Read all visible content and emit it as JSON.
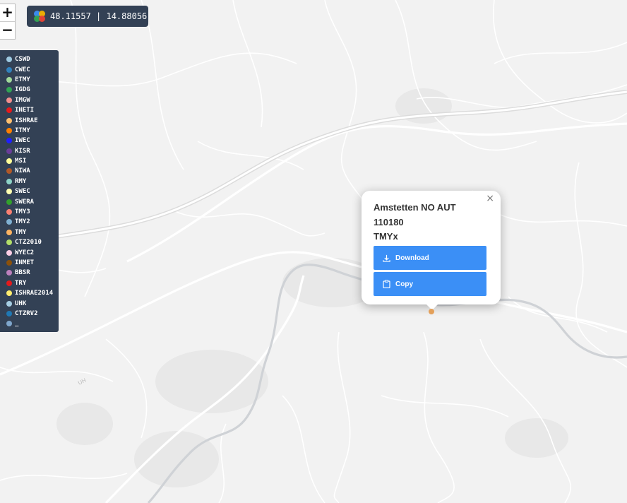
{
  "coords": {
    "text": "48.11557 | 14.88056"
  },
  "zoom": {
    "in_label": "+",
    "out_label": "−"
  },
  "legend": {
    "items": [
      {
        "label": "CSWD",
        "color": "#9ecae1"
      },
      {
        "label": "CWEC",
        "color": "#3182bd"
      },
      {
        "label": "ETMY",
        "color": "#a1d99b"
      },
      {
        "label": "IGDG",
        "color": "#31a354"
      },
      {
        "label": "IMGW",
        "color": "#f28e8e"
      },
      {
        "label": "INETI",
        "color": "#e31a1c"
      },
      {
        "label": "ISHRAE",
        "color": "#fdbf6f"
      },
      {
        "label": "ITMY",
        "color": "#ff7f00"
      },
      {
        "label": "IWEC",
        "color": "#1f1fff"
      },
      {
        "label": "KISR",
        "color": "#6a3d9a"
      },
      {
        "label": "MSI",
        "color": "#ffff99"
      },
      {
        "label": "NIWA",
        "color": "#b15928"
      },
      {
        "label": "RMY",
        "color": "#8dd3c7"
      },
      {
        "label": "SWEC",
        "color": "#ffffb3"
      },
      {
        "label": "SWERA",
        "color": "#33a02c"
      },
      {
        "label": "TMY3",
        "color": "#fb8072"
      },
      {
        "label": "TMY2",
        "color": "#80b1d3"
      },
      {
        "label": "TMY",
        "color": "#fdb462"
      },
      {
        "label": "CTZ2010",
        "color": "#b3de69"
      },
      {
        "label": "WYEC2",
        "color": "#fccde5"
      },
      {
        "label": "INMET",
        "color": "#8c510a"
      },
      {
        "label": "BBSR",
        "color": "#bc80bd"
      },
      {
        "label": "TRY",
        "color": "#e41a1c"
      },
      {
        "label": "ISHRAE2014",
        "color": "#ffed6f"
      },
      {
        "label": "UHK",
        "color": "#a6cee3"
      },
      {
        "label": "CTZRV2",
        "color": "#1f78b4"
      },
      {
        "label": "_",
        "color": "#7fa6cc"
      }
    ]
  },
  "popup": {
    "title": "Amstetten NO AUT",
    "station_id": "110180",
    "dataset": "TMYx",
    "close_label": "×",
    "download_label": "Download",
    "copy_label": "Copy"
  },
  "colors": {
    "panel": "#334155",
    "button": "#3b8ff6",
    "marker": "#e3a05a"
  }
}
